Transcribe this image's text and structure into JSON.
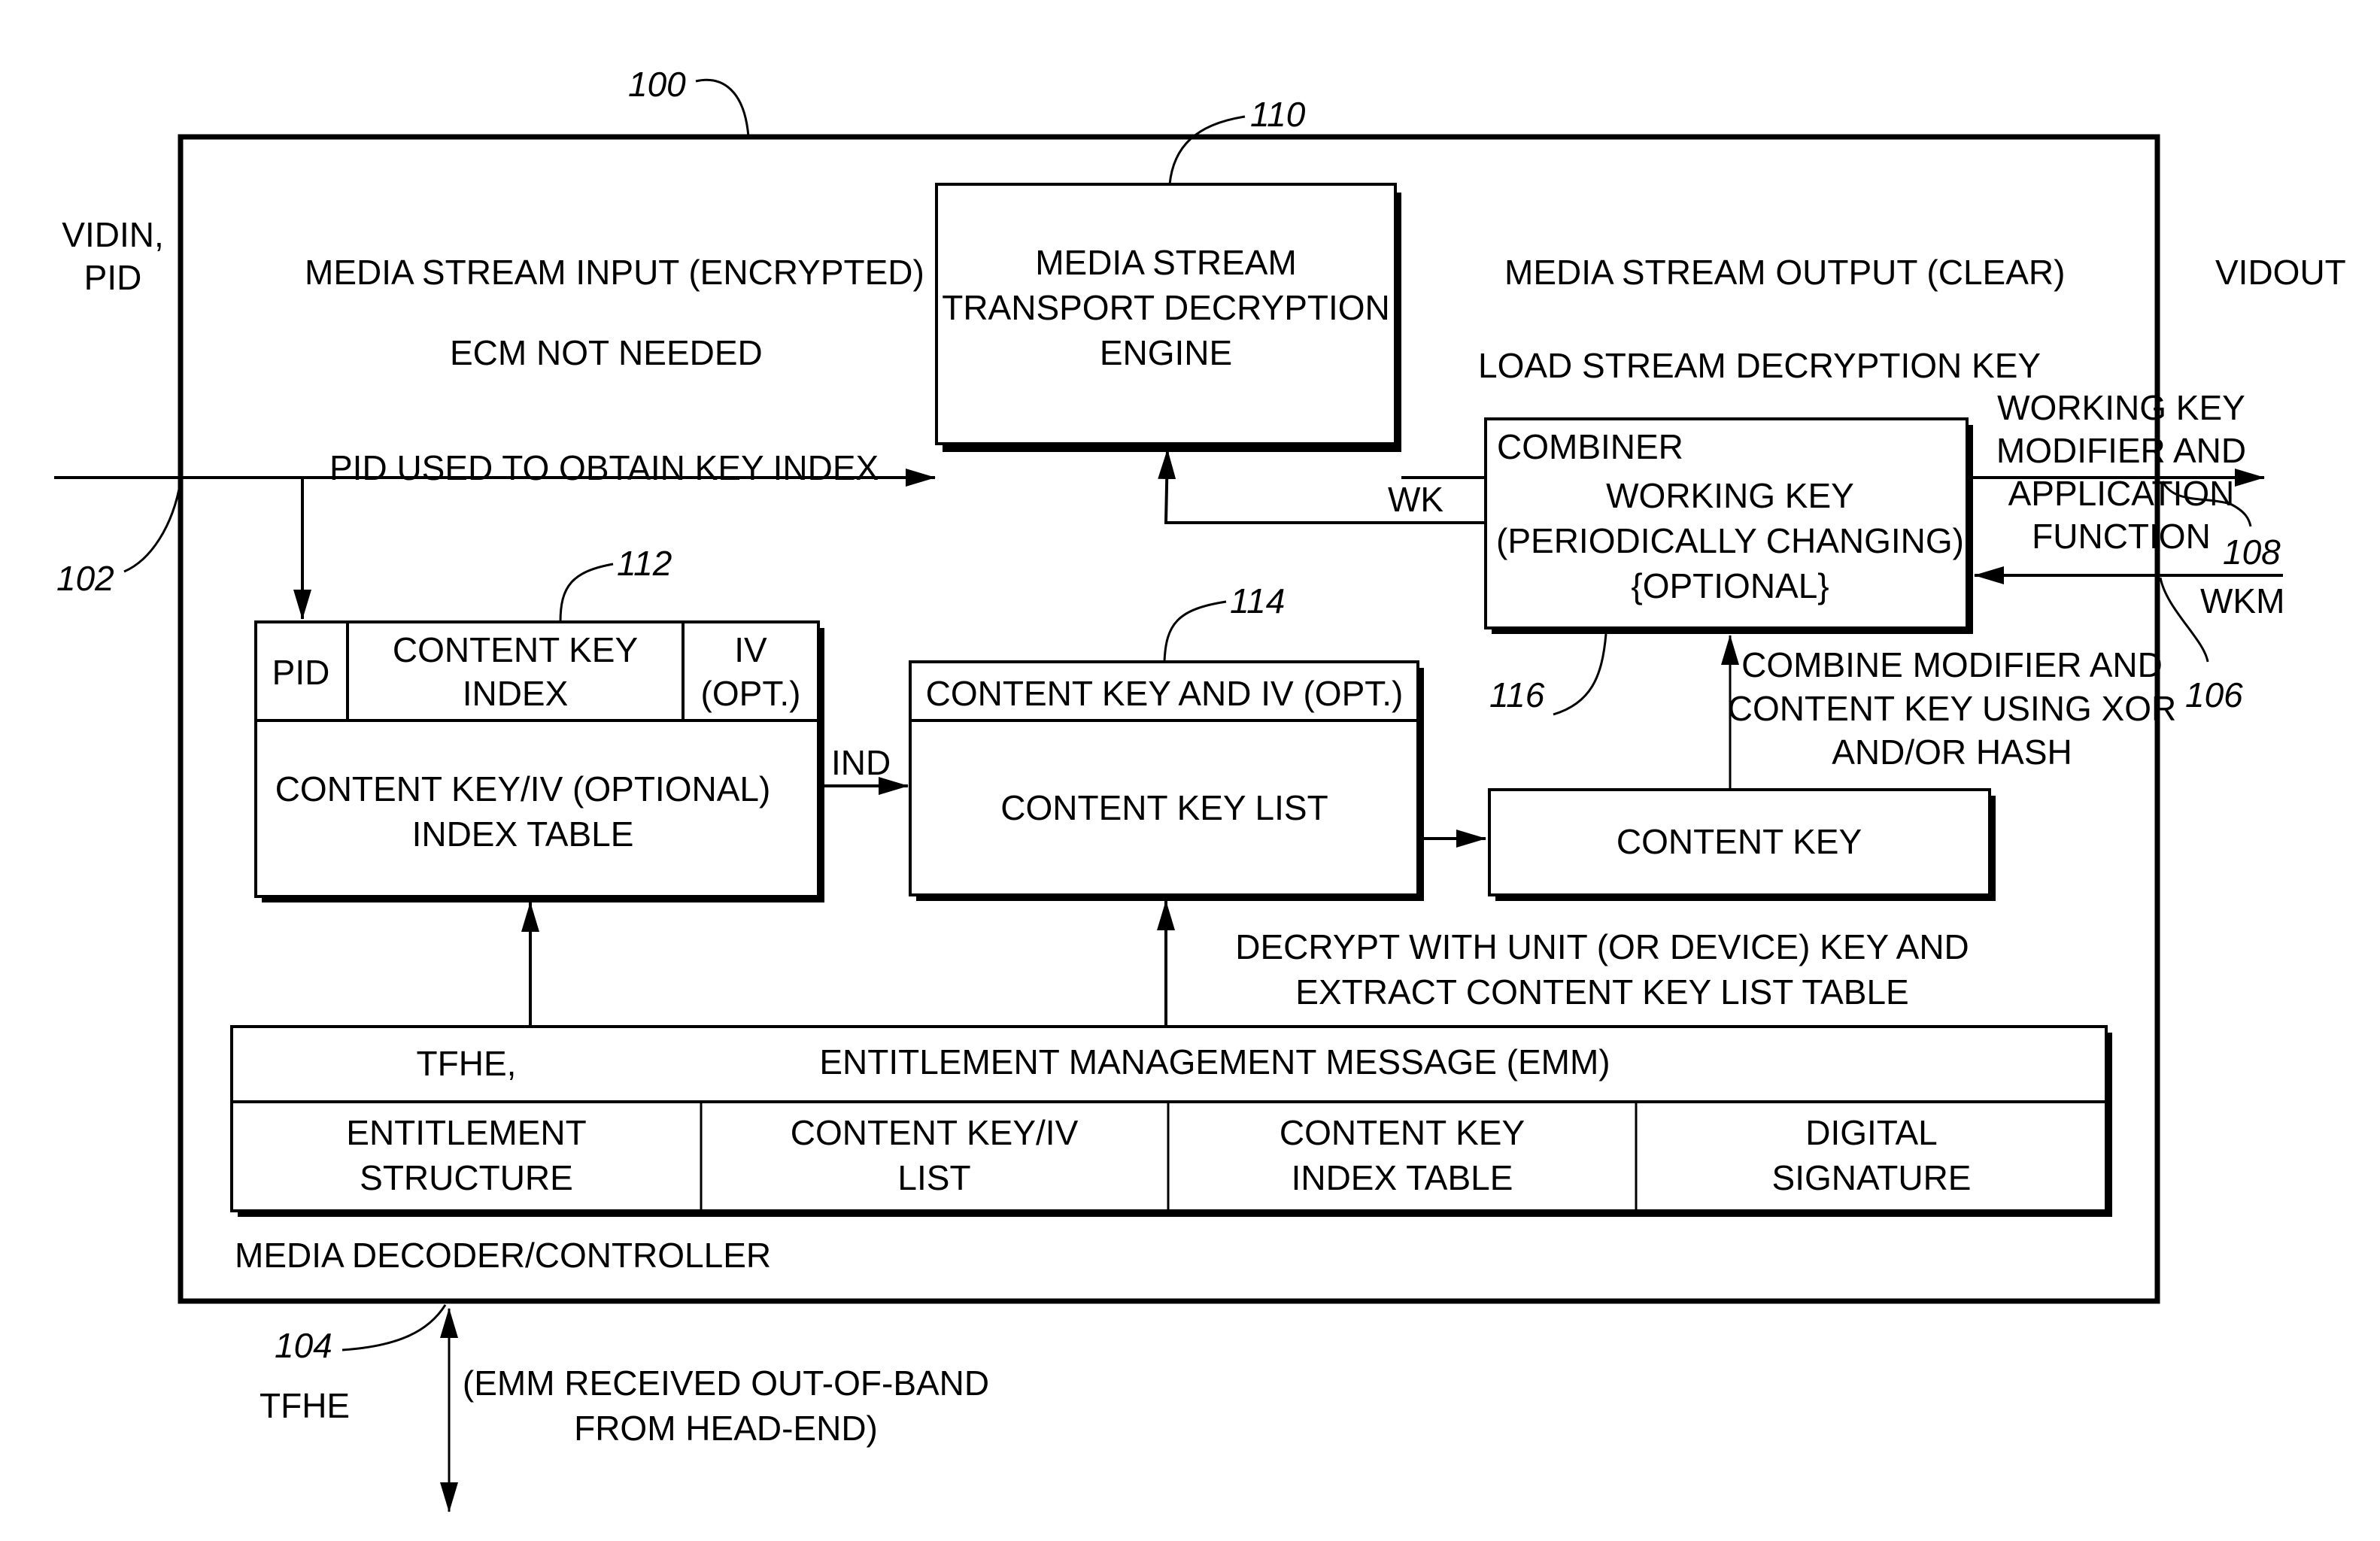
{
  "figure": {
    "outer_block": {
      "label": "MEDIA DECODER/CONTROLLER",
      "ref": "100"
    },
    "inputs": {
      "vidin_label": [
        "VIDIN,",
        "PID"
      ],
      "vidin_ref": "102",
      "media_stream_input": "MEDIA STREAM INPUT (ENCRYPTED)",
      "ecm_note": "ECM NOT NEEDED",
      "pid_note": "PID USED TO OBTAIN KEY INDEX"
    },
    "engine": {
      "ref": "110",
      "lines": [
        "MEDIA STREAM",
        "TRANSPORT DECRYPTION",
        "ENGINE"
      ]
    },
    "outputs": {
      "media_stream_output": "MEDIA STREAM OUTPUT (CLEAR)",
      "vidout_label": "VIDOUT",
      "vidout_ref": "108",
      "load_key_note": "LOAD STREAM DECRYPTION KEY"
    },
    "combiner": {
      "ref": "116",
      "title": "COMBINER",
      "lines": [
        "WORKING KEY",
        "(PERIODICALLY CHANGING)",
        "{OPTIONAL}"
      ],
      "wk_label": "WK"
    },
    "wkm": {
      "ref": "106",
      "label": "WKM",
      "description": [
        "WORKING KEY",
        "MODIFIER AND",
        "APPLICATION",
        "FUNCTION"
      ]
    },
    "combine_note": [
      "COMBINE MODIFIER AND",
      "CONTENT KEY USING XOR",
      "AND/OR HASH"
    ],
    "index_table": {
      "ref": "112",
      "header": {
        "pid": "PID",
        "content_key_index": [
          "CONTENT KEY",
          "INDEX"
        ],
        "iv": [
          "IV",
          "(OPT.)"
        ]
      },
      "body": [
        "CONTENT KEY/IV (OPTIONAL)",
        "INDEX TABLE"
      ],
      "ind_label": "IND"
    },
    "content_key_list": {
      "ref": "114",
      "header": "CONTENT KEY AND IV (OPT.)",
      "body": "CONTENT KEY LIST"
    },
    "content_key": {
      "label": "CONTENT KEY"
    },
    "decrypt_note": [
      "DECRYPT WITH UNIT (OR DEVICE) KEY AND",
      "EXTRACT CONTENT KEY LIST TABLE"
    ],
    "emm": {
      "header_prefix": "TFHE,",
      "header": "ENTITLEMENT MANAGEMENT MESSAGE (EMM)",
      "cells": [
        [
          "ENTITLEMENT",
          "STRUCTURE"
        ],
        [
          "CONTENT KEY/IV",
          "LIST"
        ],
        [
          "CONTENT KEY",
          "INDEX TABLE"
        ],
        [
          "DIGITAL",
          "SIGNATURE"
        ]
      ]
    },
    "tfhe": {
      "ref": "104",
      "label": "TFHE",
      "note": [
        "(EMM RECEIVED OUT-OF-BAND",
        "FROM HEAD-END)"
      ]
    }
  }
}
